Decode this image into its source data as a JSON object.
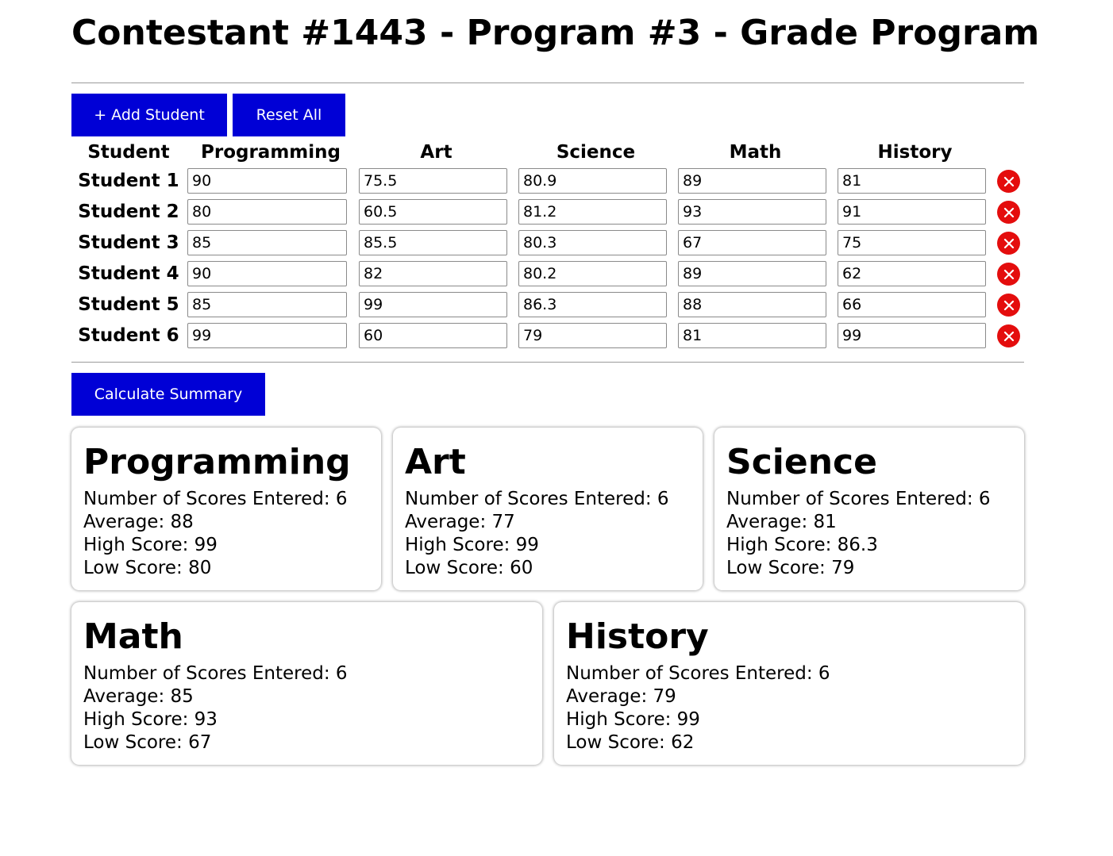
{
  "title": "Contestant #1443 - Program #3 - Grade Program",
  "toolbar": {
    "add_label": "+ Add Student",
    "reset_label": "Reset All"
  },
  "table": {
    "headers": [
      "Student",
      "Programming",
      "Art",
      "Science",
      "Math",
      "History"
    ],
    "rows": [
      {
        "label": "Student 1",
        "values": [
          "90",
          "75.5",
          "80.9",
          "89",
          "81"
        ]
      },
      {
        "label": "Student 2",
        "values": [
          "80",
          "60.5",
          "81.2",
          "93",
          "91"
        ]
      },
      {
        "label": "Student 3",
        "values": [
          "85",
          "85.5",
          "80.3",
          "67",
          "75"
        ]
      },
      {
        "label": "Student 4",
        "values": [
          "90",
          "82",
          "80.2",
          "89",
          "62"
        ]
      },
      {
        "label": "Student 5",
        "values": [
          "85",
          "99",
          "86.3",
          "88",
          "66"
        ]
      },
      {
        "label": "Student 6",
        "values": [
          "99",
          "60",
          "79",
          "81",
          "99"
        ]
      }
    ]
  },
  "calculate_label": "Calculate Summary",
  "summary": [
    {
      "subject": "Programming",
      "count": "Number of Scores Entered: 6",
      "average": "Average: 88",
      "high": "High Score: 99",
      "low": "Low Score: 80"
    },
    {
      "subject": "Art",
      "count": "Number of Scores Entered: 6",
      "average": "Average: 77",
      "high": "High Score: 99",
      "low": "Low Score: 60"
    },
    {
      "subject": "Science",
      "count": "Number of Scores Entered: 6",
      "average": "Average: 81",
      "high": "High Score: 86.3",
      "low": "Low Score: 79"
    },
    {
      "subject": "Math",
      "count": "Number of Scores Entered: 6",
      "average": "Average: 85",
      "high": "High Score: 93",
      "low": "Low Score: 67"
    },
    {
      "subject": "History",
      "count": "Number of Scores Entered: 6",
      "average": "Average: 79",
      "high": "High Score: 99",
      "low": "Low Score: 62"
    }
  ],
  "colors": {
    "button": "#0000d6",
    "delete": "#e40d0d"
  },
  "icons": {
    "delete": "close-icon"
  }
}
